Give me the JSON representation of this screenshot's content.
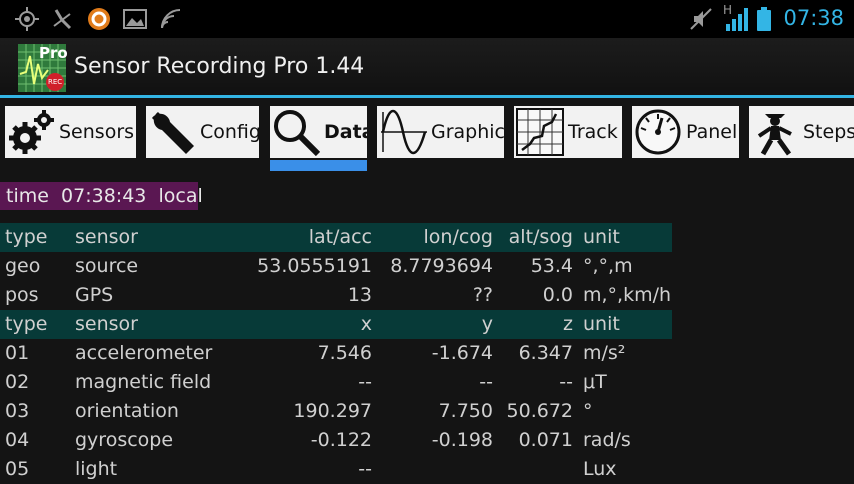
{
  "status_bar": {
    "icons": [
      "gps-icon",
      "missed-call-icon",
      "avast-icon",
      "gallery-icon",
      "wifi-calling-icon"
    ],
    "right_icons": [
      "mute-icon",
      "signal-h-icon",
      "battery-icon"
    ],
    "network_type": "H",
    "time": "07:38",
    "accent_color": "#33b5e5"
  },
  "app": {
    "icon_badge_top": "Pro",
    "icon_badge_rec": "REC",
    "title": "Sensor Recording Pro 1.44"
  },
  "tabs": [
    {
      "label": "Sensors",
      "icon": "gears-icon",
      "active": false
    },
    {
      "label": "Config",
      "icon": "wrench-icon",
      "active": false
    },
    {
      "label": "Data",
      "icon": "magnifier-icon",
      "active": true
    },
    {
      "label": "Graphic",
      "icon": "sine-wave-icon",
      "active": false
    },
    {
      "label": "Track",
      "icon": "track-map-icon",
      "active": false
    },
    {
      "label": "Panel",
      "icon": "gauge-icon",
      "active": false
    },
    {
      "label": "Steps",
      "icon": "walking-man-icon",
      "active": false
    }
  ],
  "time_row": {
    "label": "time",
    "value": "07:38:43",
    "zone": "local",
    "color": "#5a1752"
  },
  "geo_table": {
    "header": [
      "type",
      "sensor",
      "lat/acc",
      "lon/cog",
      "alt/sog",
      "unit"
    ],
    "rows": [
      [
        "geo",
        "source",
        "53.0555191",
        "8.7793694",
        "53.4",
        "°,°,m"
      ],
      [
        "pos",
        "GPS",
        "13",
        "??",
        "0.0",
        "m,°,km/h"
      ]
    ]
  },
  "sensor_table": {
    "header": [
      "type",
      "sensor",
      "x",
      "y",
      "z",
      "unit"
    ],
    "rows": [
      [
        "01",
        "accelerometer",
        "7.546",
        "-1.674",
        "6.347",
        "m/s²"
      ],
      [
        "02",
        "magnetic field",
        "--",
        "--",
        "--",
        "μT"
      ],
      [
        "03",
        "orientation",
        "190.297",
        "7.750",
        "50.672",
        "°"
      ],
      [
        "04",
        "gyroscope",
        "-0.122",
        "-0.198",
        "0.071",
        "rad/s"
      ],
      [
        "05",
        "light",
        "--",
        "",
        "",
        "Lux"
      ]
    ]
  },
  "header_color": "#073a38"
}
